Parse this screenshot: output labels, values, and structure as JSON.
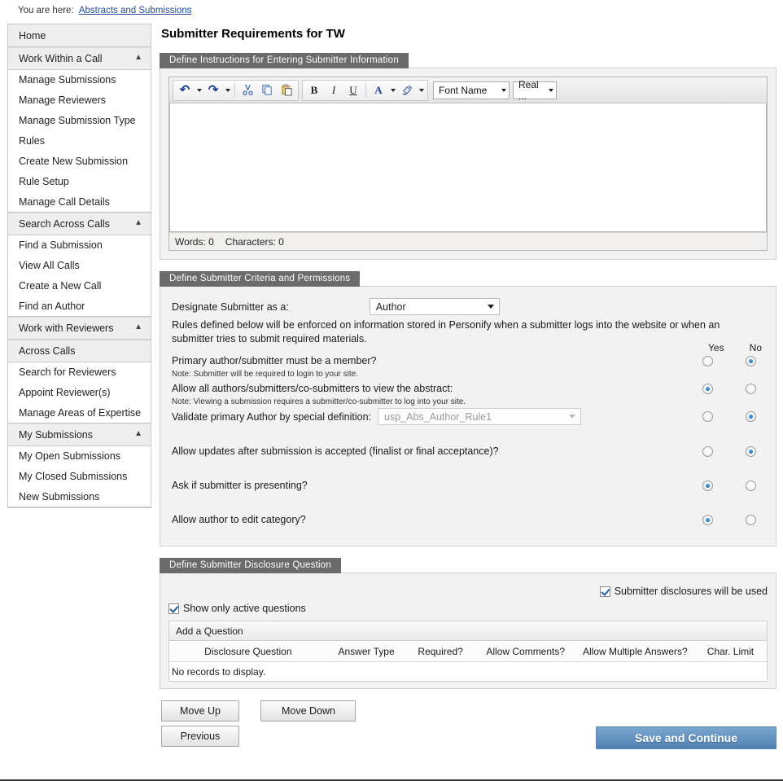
{
  "breadcrumb": {
    "label": "You are here:",
    "link": "Abstracts and Submissions"
  },
  "sidebar": {
    "items": [
      {
        "label": "Home",
        "type": "group",
        "chevron": ""
      },
      {
        "label": "Work Within a Call",
        "type": "group",
        "chevron": "chevron-up-icon"
      },
      {
        "label": "Manage Submissions",
        "type": "item"
      },
      {
        "label": "Manage Reviewers",
        "type": "item"
      },
      {
        "label": "Manage Submission Type",
        "type": "item"
      },
      {
        "label": "Rules",
        "type": "item"
      },
      {
        "label": "Create New Submission",
        "type": "item"
      },
      {
        "label": "Rule Setup",
        "type": "item"
      },
      {
        "label": "Manage Call Details",
        "type": "item"
      },
      {
        "label": "Search Across Calls",
        "type": "group",
        "chevron": "chevron-up-icon"
      },
      {
        "label": "Find a Submission",
        "type": "item"
      },
      {
        "label": "View All Calls",
        "type": "item"
      },
      {
        "label": "Create a New Call",
        "type": "item"
      },
      {
        "label": "Find an Author",
        "type": "item"
      },
      {
        "label": "Work with Reviewers",
        "type": "group",
        "chevron": "chevron-up-icon"
      },
      {
        "label": "Across Calls",
        "type": "group",
        "chevron": ""
      },
      {
        "label": "Search for Reviewers",
        "type": "item"
      },
      {
        "label": "Appoint Reviewer(s)",
        "type": "item"
      },
      {
        "label": "Manage Areas of Expertise",
        "type": "item"
      },
      {
        "label": "My Submissions",
        "type": "group",
        "chevron": "chevron-up-icon"
      },
      {
        "label": "My Open Submissions",
        "type": "item"
      },
      {
        "label": "My Closed Submissions",
        "type": "item"
      },
      {
        "label": "New Submissions",
        "type": "item"
      }
    ]
  },
  "main": {
    "title": "Submitter Requirements for  TW"
  },
  "instructions_panel": {
    "legend": "Define Instructions for Entering Submitter Information",
    "toolbar": {
      "undo": "↶",
      "redo": "↷",
      "cut": "✂",
      "copy": "copy-icon",
      "paste": "paste-icon",
      "bold": "B",
      "italic": "I",
      "underline": "U",
      "font_color": "A",
      "highlight": "highlight-icon",
      "font_name": "Font Name",
      "font_size": "Real ..."
    },
    "content": "",
    "status": {
      "words": "Words: 0",
      "characters": "Characters: 0"
    }
  },
  "criteria_panel": {
    "legend": "Define Submitter Criteria and Permissions",
    "designate_label": "Designate Submitter as a:",
    "designate_value": "Author",
    "rules_text": "Rules defined below will be enforced on information stored in Personify when a submitter logs into the website or when an submitter tries to submit required materials.",
    "yes_header": "Yes",
    "no_header": "No",
    "questions": [
      {
        "text": "Primary author/submitter must be a member?",
        "note": "Note: Submitter will be required to login to your site.",
        "yes": false,
        "no": true
      },
      {
        "text": "Allow all authors/submitters/co-submitters to view the abstract:",
        "note": "Note: Viewing a submission requires a submitter/co-submitter to log into your site.",
        "yes": true,
        "no": false
      },
      {
        "text": "Validate primary Author by special definition:",
        "note": "",
        "select_value": "usp_Abs_Author_Rule1",
        "yes": false,
        "no": true
      },
      {
        "text": "Allow updates after submission is accepted (finalist or final acceptance)?",
        "note": "",
        "yes": false,
        "no": true
      },
      {
        "text": "Ask if submitter is presenting?",
        "note": "",
        "yes": true,
        "no": false
      },
      {
        "text": "Allow author to edit category?",
        "note": "",
        "yes": true,
        "no": false
      }
    ]
  },
  "disclosure_panel": {
    "legend": "Define Submitter Disclosure Question",
    "disclosures_used_label": "Submitter disclosures will be used",
    "disclosures_used_checked": true,
    "show_active_label": "Show only active questions",
    "show_active_checked": true,
    "add_question_label": "Add a Question",
    "columns": [
      "Disclosure Question",
      "Answer Type",
      "Required?",
      "Allow Comments?",
      "Allow Multiple Answers?",
      "Char. Limit"
    ],
    "empty_text": "No records to display."
  },
  "buttons": {
    "move_up": "Move Up",
    "move_down": "Move Down",
    "previous": "Previous",
    "save_continue": "Save and Continue"
  },
  "colors": {
    "legend_bg": "#6b6b6b",
    "primary_button": "#4f81b3",
    "link": "#1f4b99",
    "radio_dot": "#1b6fba"
  }
}
